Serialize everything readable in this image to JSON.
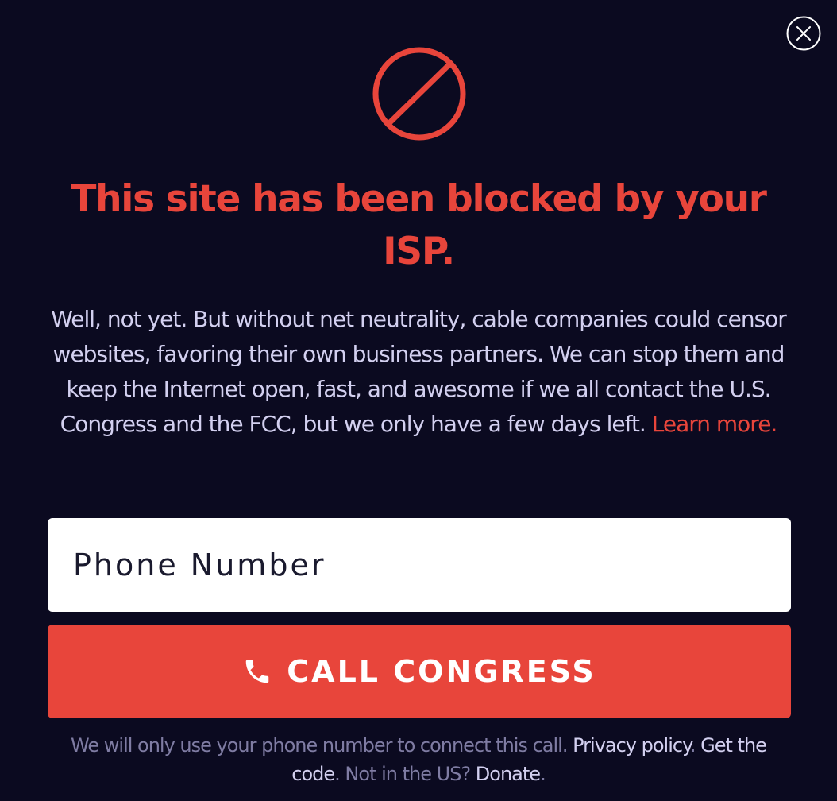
{
  "colors": {
    "background": "#0b0a20",
    "accent_red": "#e8453b",
    "body_text": "#d3d0f0",
    "muted_text": "#7f7ca3",
    "footer_link": "#d3d0f0"
  },
  "close_button": {
    "icon": "close-icon"
  },
  "block_icon": {
    "icon": "prohibited-icon"
  },
  "headline": "This site has been blocked by your ISP.",
  "body": {
    "text": "Well, not yet. But without net neutrality, cable companies could censor websites, favoring their own business partners. We can stop them and keep the Internet open, fast, and awesome if we all contact the U.S. Congress and the FCC, but we only have a few days left. ",
    "learn_more_label": "Learn more."
  },
  "phone_input": {
    "placeholder": "Phone Number",
    "value": ""
  },
  "call_button": {
    "icon": "phone-icon",
    "label": "CALL CONGRESS"
  },
  "footer": {
    "notice": "We will only use your phone number to connect this call. ",
    "privacy_label": "Privacy policy",
    "sep1": ". ",
    "get_code_label": "Get the code",
    "sep2": ". Not in the US? ",
    "donate_label": "Donate",
    "end": "."
  }
}
